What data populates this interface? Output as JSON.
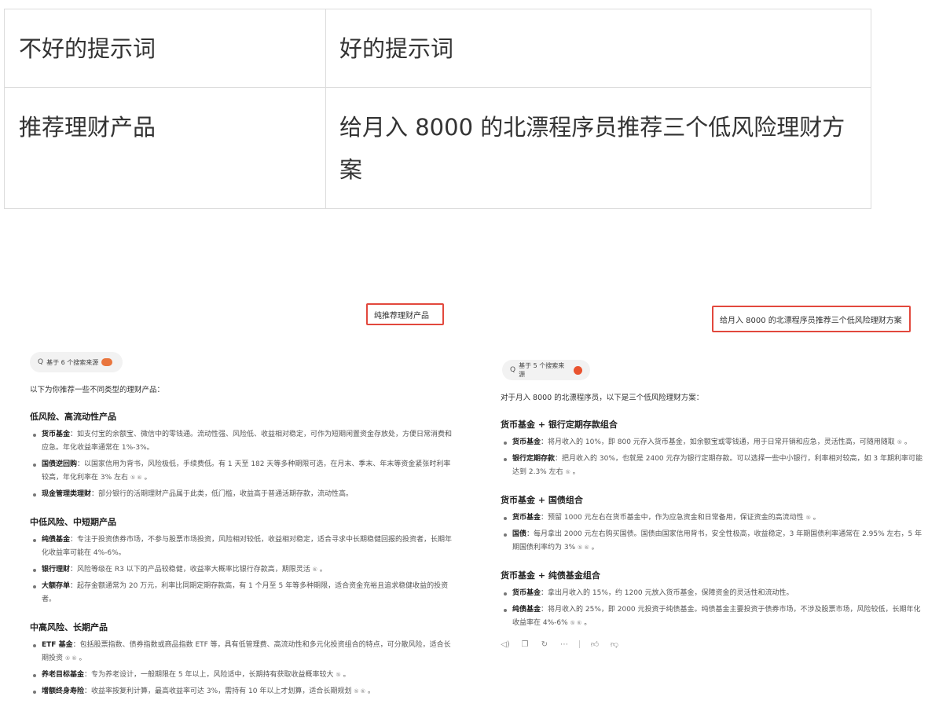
{
  "table": {
    "header": {
      "bad": "不好的提示词",
      "good": "好的提示词"
    },
    "row": {
      "bad": "推荐理财产品",
      "good": "给月入  8000  的北漂程序员推荐三个低风险理财方案"
    }
  },
  "left": {
    "user_prompt": "纯推荐理财产品",
    "source_chip": "基于 6 个搜索来源",
    "intro": "以下为你推荐一些不同类型的理财产品：",
    "sections": [
      {
        "title": "低风险、高流动性产品",
        "items": [
          {
            "name": "货币基金",
            "text": "：如支付宝的余额宝、微信中的零钱通。流动性强、风险低、收益相对稳定，可作为短期闲置资金存放处，方便日常消费和应急。年化收益率通常在 1%-3%。",
            "refs": ""
          },
          {
            "name": "国债逆回购",
            "text": "：以国家信用为背书，风险极低，手续费低。有 1 天至 182 天等多种期限可选，在月末、季末、年末等资金紧张时利率较高，年化利率在 3% 左右",
            "refs": "⑤ ⑥"
          },
          {
            "name": "现金管理类理财",
            "text": "：部分银行的活期理财产品属于此类，低门槛，收益高于普通活期存款，流动性高。",
            "refs": ""
          }
        ]
      },
      {
        "title": "中低风险、中短期产品",
        "items": [
          {
            "name": "纯债基金",
            "text": "：专注于投资债券市场，不参与股票市场投资，风险相对较低，收益相对稳定，适合寻求中长期稳健回报的投资者，长期年化收益率可能在 4%-6%。",
            "refs": ""
          },
          {
            "name": "银行理财",
            "text": "：风险等级在 R3 以下的产品较稳健，收益率大概率比银行存款高，期限灵活",
            "refs": "⑥"
          },
          {
            "name": "大额存单",
            "text": "：起存金额通常为 20 万元，利率比同期定期存款高，有 1 个月至 5 年等多种期限，适合资金充裕且追求稳健收益的投资者。",
            "refs": ""
          }
        ]
      },
      {
        "title": "中高风险、长期产品",
        "items": [
          {
            "name": "ETF 基金",
            "text": "：包括股票指数、债券指数或商品指数 ETF 等，具有低管理费、高流动性和多元化投资组合的特点，可分散风险，适合长期投资",
            "refs": "⑤ ⑥"
          },
          {
            "name": "养老目标基金",
            "text": "：专为养老设计，一般期限在 5 年以上，风险适中，长期持有获取收益概率较大",
            "refs": "⑤"
          },
          {
            "name": "增额终身寿险",
            "text": "：收益率按复利计算，最高收益率可达 3%，需持有 10 年以上才划算，适合长期规划",
            "refs": "⑤ ⑥"
          }
        ]
      }
    ]
  },
  "right": {
    "user_prompt": "给月入 8000 的北漂程序员推荐三个低风险理财方案",
    "source_chip": "基于 5 个搜索来源",
    "intro": "对于月入 8000 的北漂程序员，以下是三个低风险理财方案：",
    "sections": [
      {
        "title": "货币基金 + 银行定期存款组合",
        "items": [
          {
            "name": "货币基金",
            "text": "：将月收入的 10%，即 800 元存入货币基金，如余额宝或零钱通，用于日常开销和应急，灵活性高，可随用随取",
            "refs": "⑤"
          },
          {
            "name": "银行定期存款",
            "text": "：把月收入的 30%，也就是 2400 元存为银行定期存款。可以选择一些中小银行，利率相对较高，如 3 年期利率可能达到 2.3% 左右",
            "refs": "⑤"
          }
        ]
      },
      {
        "title": "货币基金 + 国债组合",
        "items": [
          {
            "name": "货币基金",
            "text": "：预留 1000 元左右在货币基金中，作为应急资金和日常备用，保证资金的高流动性",
            "refs": "⑤"
          },
          {
            "name": "国债",
            "text": "：每月拿出 2000 元左右购买国债。国债由国家信用背书，安全性极高，收益稳定，3 年期国债利率通常在 2.95% 左右，5 年期国债利率约为 3%",
            "refs": "⑤ ⑥"
          }
        ]
      },
      {
        "title": "货币基金 + 纯债基金组合",
        "items": [
          {
            "name": "货币基金",
            "text": "：拿出月收入的 15%，约 1200 元放入货币基金，保障资金的灵活性和流动性。",
            "refs": ""
          },
          {
            "name": "纯债基金",
            "text": "：将月收入的 25%，即 2000 元投资于纯债基金。纯债基金主要投资于债券市场，不涉及股票市场，风险较低，长期年化收益率在 4%-6%",
            "refs": "⑤ ⑥"
          }
        ]
      }
    ],
    "actions": [
      "speaker-icon",
      "copy-icon",
      "refresh-icon",
      "more-icon",
      "thumbs-up-icon",
      "thumbs-down-icon"
    ]
  },
  "colors": {
    "highlight_border": "#e2483d",
    "chip_bg": "#f2f2f2",
    "table_border": "#dcdcdc"
  }
}
